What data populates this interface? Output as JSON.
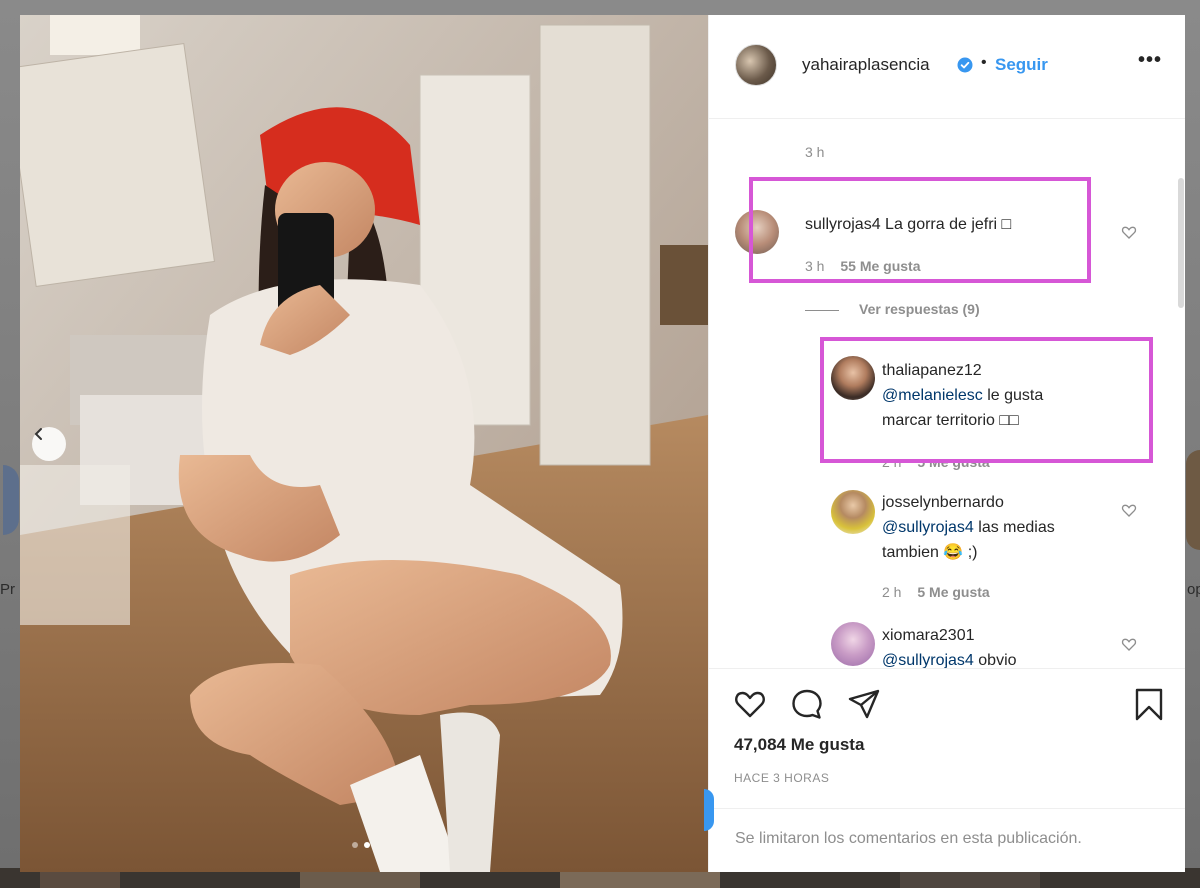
{
  "background": {
    "left_text": "Pr",
    "right_text": "op"
  },
  "post": {
    "author": {
      "username": "yahairaplasencia",
      "verified": true,
      "follow_label": "Seguir",
      "separator": "•"
    },
    "more_icon": "more-horizontal-icon",
    "carousel": {
      "slide_count": 2,
      "active_slide": 2
    },
    "top_time": "3 h",
    "comments": [
      {
        "username": "sullyrojas4",
        "text": "La gorra de jefri □",
        "time": "3 h",
        "likes": "55 Me gusta",
        "highlighted": true
      }
    ],
    "view_replies": "Ver respuestas (9)",
    "replies": [
      {
        "username": "thaliapanez12",
        "mention": "@melanielesc",
        "text_line1": "le gusta",
        "text_line2": "marcar territorio □□",
        "time": "2 h",
        "likes": "5 Me gusta",
        "highlighted": true
      },
      {
        "username": "josselynbernardo",
        "mention": "@sullyrojas4",
        "text_line1": "las medias",
        "text_line2": "tambien 😂 ;)",
        "time": "2 h",
        "likes": "5 Me gusta"
      },
      {
        "username": "xiomara2301",
        "mention": "@sullyrojas4",
        "text_line1": "obvio"
      }
    ],
    "likes_count": "47,084 Me gusta",
    "posted_ago": "HACE 3 HORAS",
    "comments_limited": "Se limitaron los comentarios en esta publicación.",
    "colors": {
      "link_blue": "#3897f0",
      "mention_blue": "#00376b",
      "highlight_box": "#d657d6",
      "text_primary": "#262626",
      "text_secondary": "#8e8e8e"
    }
  }
}
